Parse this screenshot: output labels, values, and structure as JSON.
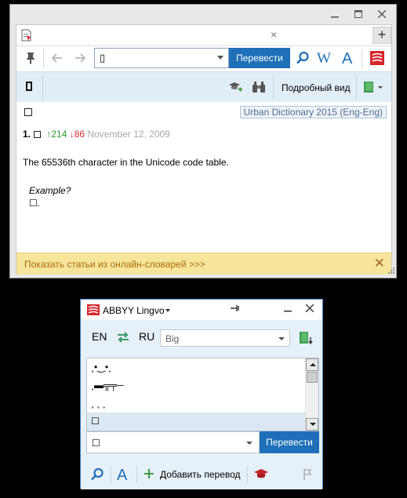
{
  "main_window": {
    "tabs": [
      {
        "close_glyph": "×"
      }
    ],
    "add_tab_glyph": "+",
    "search": {
      "value": "▯"
    },
    "translate_label": "Перевести",
    "view_mode_label": "Подробный вид",
    "headword": "☐",
    "dictionary_name": "Urban Dictionary 2015 (Eng-Eng)",
    "entry": {
      "number": "1.",
      "upvotes": "↑214",
      "downvotes": "↓86",
      "date": "November 12, 2009"
    },
    "definition": "The 65536th character in the Unicode code table.",
    "example_label": "Example?",
    "example_text": "☐.",
    "online_bar_label": "Показать статьи из онлайн-словарей >>>",
    "online_bar_close": "✕",
    "icons": [
      "pin-icon",
      "back-icon",
      "forward-icon",
      "search-icon",
      "wikipedia-icon",
      "font-icon",
      "lingvo-logo-icon",
      "graduation-cap-plus-icon",
      "binoculars-icon",
      "book-icon"
    ],
    "accent_color": "#1f70b8",
    "online_bar_color": "#f6e59a"
  },
  "mini_window": {
    "title": "ABBYY Lingvo",
    "source_lang": "EN",
    "target_lang": "RU",
    "dictionary_select": "Big",
    "list_items": [
      {
        "text": "˳•‿•˳"
      },
      {
        "text": "˳▬╦╤─"
      },
      {
        "text": "˳ ˳ ˳"
      },
      {
        "text": "☐",
        "selected": true
      }
    ],
    "input_value": "☐",
    "translate_label": "Перевести",
    "add_translation_label": "Добавить перевод",
    "icons": [
      "search-icon",
      "font-icon",
      "plus-icon",
      "graduation-cap-icon",
      "flag-icon",
      "swap-icon",
      "dictionary-book-icon"
    ]
  }
}
